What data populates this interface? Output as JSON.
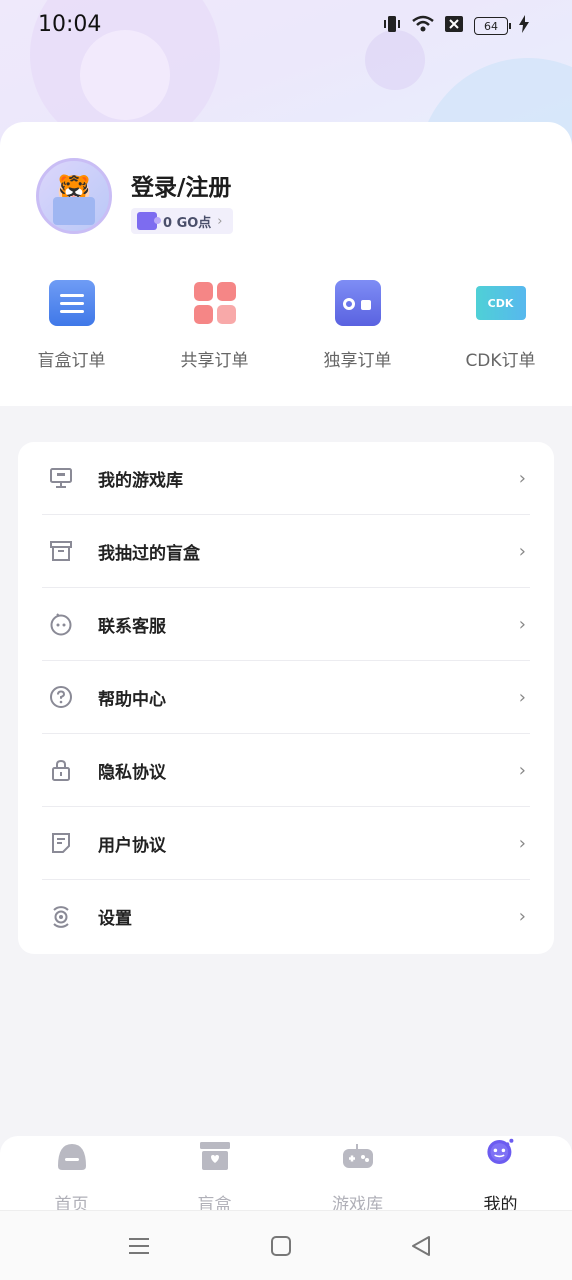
{
  "status_bar": {
    "time": "10:04",
    "battery": "64"
  },
  "profile": {
    "title": "登录/注册",
    "points_label": "0 GO点"
  },
  "orders": [
    {
      "label": "盲盒订单",
      "icon": "clipboard-icon"
    },
    {
      "label": "共享订单",
      "icon": "grid-share-icon"
    },
    {
      "label": "独享订单",
      "icon": "radio-icon"
    },
    {
      "label": "CDK订单",
      "icon": "ticket-cdk-icon",
      "badge": "CDK"
    }
  ],
  "menu": [
    {
      "label": "我的游戏库",
      "icon": "monitor-icon"
    },
    {
      "label": "我抽过的盲盒",
      "icon": "archive-box-icon"
    },
    {
      "label": "联系客服",
      "icon": "customer-service-icon"
    },
    {
      "label": "帮助中心",
      "icon": "help-circle-icon"
    },
    {
      "label": "隐私协议",
      "icon": "lock-icon"
    },
    {
      "label": "用户协议",
      "icon": "document-icon"
    },
    {
      "label": "设置",
      "icon": "settings-icon"
    }
  ],
  "bottom_nav": [
    {
      "label": "首页",
      "icon": "home-icon",
      "active": false
    },
    {
      "label": "盲盒",
      "icon": "blind-box-icon",
      "active": false
    },
    {
      "label": "游戏库",
      "icon": "gamepad-icon",
      "active": false
    },
    {
      "label": "我的",
      "icon": "mascot-icon",
      "active": true
    }
  ],
  "colors": {
    "accent": "#6c5cf0",
    "background": "#f4f4f7",
    "text": "#222222"
  }
}
